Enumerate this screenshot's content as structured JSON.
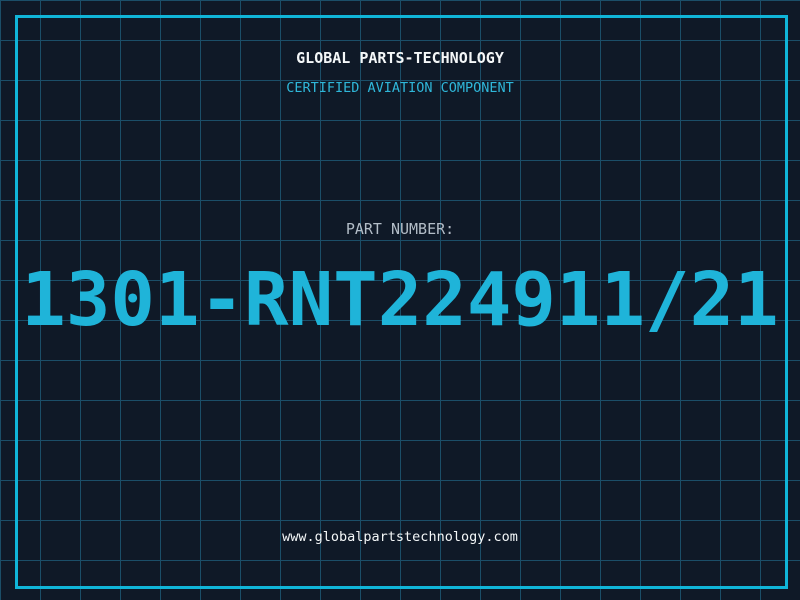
{
  "header": {
    "company": "GLOBAL PARTS-TECHNOLOGY",
    "tagline": "CERTIFIED AVIATION COMPONENT"
  },
  "part": {
    "label": "PART NUMBER:",
    "number": "1301-RNT224911/21"
  },
  "footer": {
    "website": "www.globalpartstechnology.com"
  },
  "colors": {
    "background": "#0f1927",
    "grid_line": "#1b4e68",
    "frame_cyan": "#10b5d8",
    "part_number_cyan": "#1fb4d9",
    "tagline_cyan": "#2fb7d9",
    "label_gray": "#b3bdc7",
    "text_white": "#f4f7f8"
  }
}
